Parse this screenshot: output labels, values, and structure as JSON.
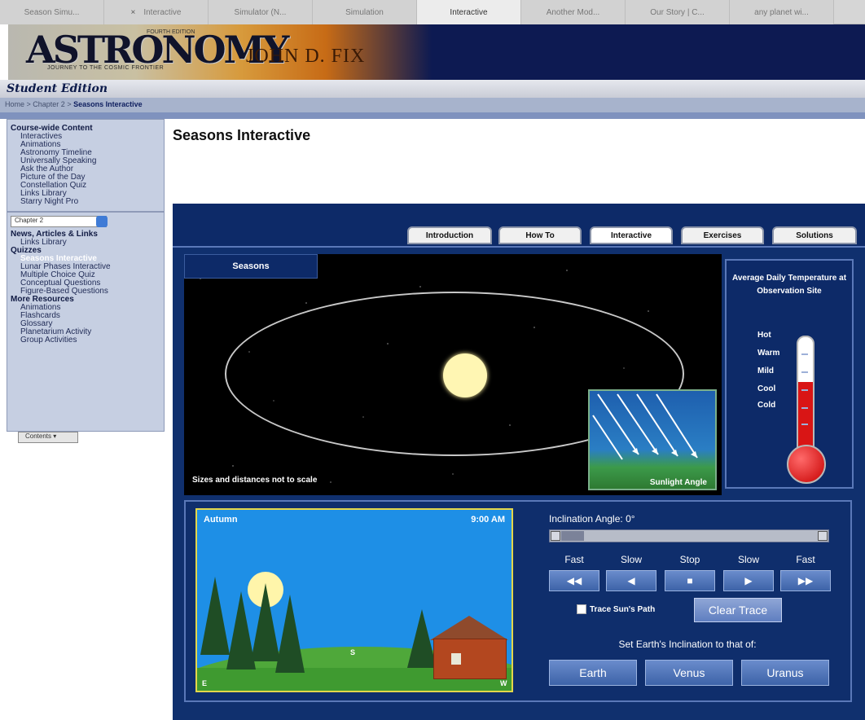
{
  "browser": {
    "tabs": [
      {
        "label": "Season Simu...",
        "active": false
      },
      {
        "label": "Interactive",
        "active": false
      },
      {
        "label": "Simulator (N...",
        "active": false
      },
      {
        "label": "Simulation",
        "active": false
      },
      {
        "label": "Interactive",
        "active": true
      },
      {
        "label": "Another Mod...",
        "active": false
      },
      {
        "label": "Our Story | C...",
        "active": false
      },
      {
        "label": "any planet wi...",
        "active": false
      }
    ]
  },
  "banner": {
    "logo": "ASTRONOMY",
    "tagline": "JOURNEY TO THE COSMIC FRONTIER",
    "edition_tiny": "FOURTH EDITION",
    "author": "JOHN D. FIX"
  },
  "edition_label": "Student Edition",
  "breadcrumb": {
    "home": "Home",
    "sep": " > ",
    "chapter": "Chapter 2",
    "current": "Seasons Interactive"
  },
  "sidebar": {
    "course_heading": "Course-wide Content",
    "course_items": [
      "Interactives",
      "Animations",
      "Astronomy Timeline",
      "Universally Speaking",
      "Ask the Author",
      "Picture of the Day",
      "Constellation Quiz",
      "Links Library",
      "Starry Night Pro"
    ],
    "chapter_select": "Chapter 2",
    "news_heading": "News, Articles & Links",
    "news_items": [
      "Links Library"
    ],
    "quizzes_heading": "Quizzes",
    "quiz_items": [
      "Seasons Interactive",
      "Lunar Phases Interactive",
      "Multiple Choice Quiz",
      "Conceptual Questions",
      "Figure-Based Questions"
    ],
    "quiz_selected": "Seasons Interactive",
    "more_heading": "More Resources",
    "more_items": [
      "Animations",
      "Flashcards",
      "Glossary",
      "Planetarium Activity",
      "Group Activities"
    ],
    "contents_button": "Contents"
  },
  "page_title": "Seasons Interactive",
  "applet": {
    "tabs": [
      "Introduction",
      "How To",
      "Interactive",
      "Exercises",
      "Solutions"
    ],
    "active_tab": "Interactive",
    "space_tab": "Seasons",
    "scale_note": "Sizes and distances not to scale",
    "sunlight_label": "Sunlight Angle",
    "thermometer": {
      "title": "Average Daily Temperature at Observation Site",
      "levels": [
        "Hot",
        "Warm",
        "Mild",
        "Cool",
        "Cold"
      ],
      "fill_fraction": 0.62
    },
    "scene": {
      "season": "Autumn",
      "time": "9:00 AM",
      "dir_east": "E",
      "dir_south": "S",
      "dir_west": "W"
    },
    "inclination_label": "Inclination Angle: 0°",
    "inclination_value": 0,
    "speed_labels": [
      "Fast",
      "Slow",
      "Stop",
      "Slow",
      "Fast"
    ],
    "playback_icons": [
      "◀◀",
      "◀",
      "■",
      "▶",
      "▶▶"
    ],
    "trace_label": "Trace Sun's Path",
    "clear_trace": "Clear Trace",
    "set_inclination_label": "Set Earth's Inclination to that of:",
    "planets": [
      "Earth",
      "Venus",
      "Uranus"
    ]
  },
  "colors": {
    "applet_bg": "#0b2257",
    "sky": "#1e8fe6",
    "mercury": "#d91515",
    "sun": "#fff6b3"
  }
}
